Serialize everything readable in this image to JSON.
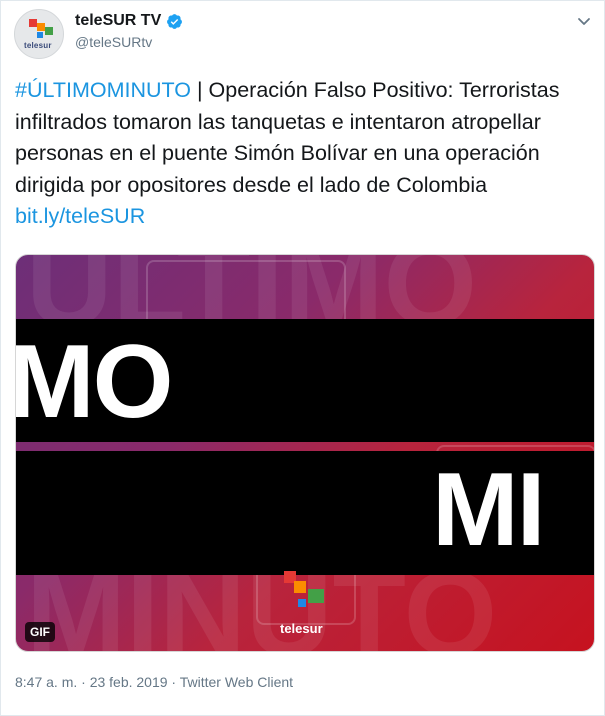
{
  "tweet": {
    "display_name": "teleSUR TV",
    "handle": "@teleSURtv",
    "hashtag": "#ÚLTIMOMINUTO",
    "body": " | Operación Falso Positivo: Terroristas infiltrados tomaron las tanquetas e intentaron atropellar personas en el puente Simón Bolívar en una operación dirigida por opositores desde el lado de Colombia ",
    "link": "bit.ly/teleSUR",
    "timestamp": "8:47 a. m. · 23 feb. 2019 · Twitter Web Client"
  },
  "avatar": {
    "logo_text": "telesur"
  },
  "media": {
    "band_text_1": "MO",
    "band_text_2": "MI",
    "ghost_text_top": "ÚLTIMO",
    "ghost_text_bottom": "MINUTO",
    "gif_label": "GIF",
    "logo_text": "telesur"
  },
  "colors": {
    "link": "#1b95e0",
    "verified": "#1da1f2",
    "meta": "#657786"
  },
  "icons": [
    "verified-badge-icon",
    "chevron-down-icon"
  ]
}
